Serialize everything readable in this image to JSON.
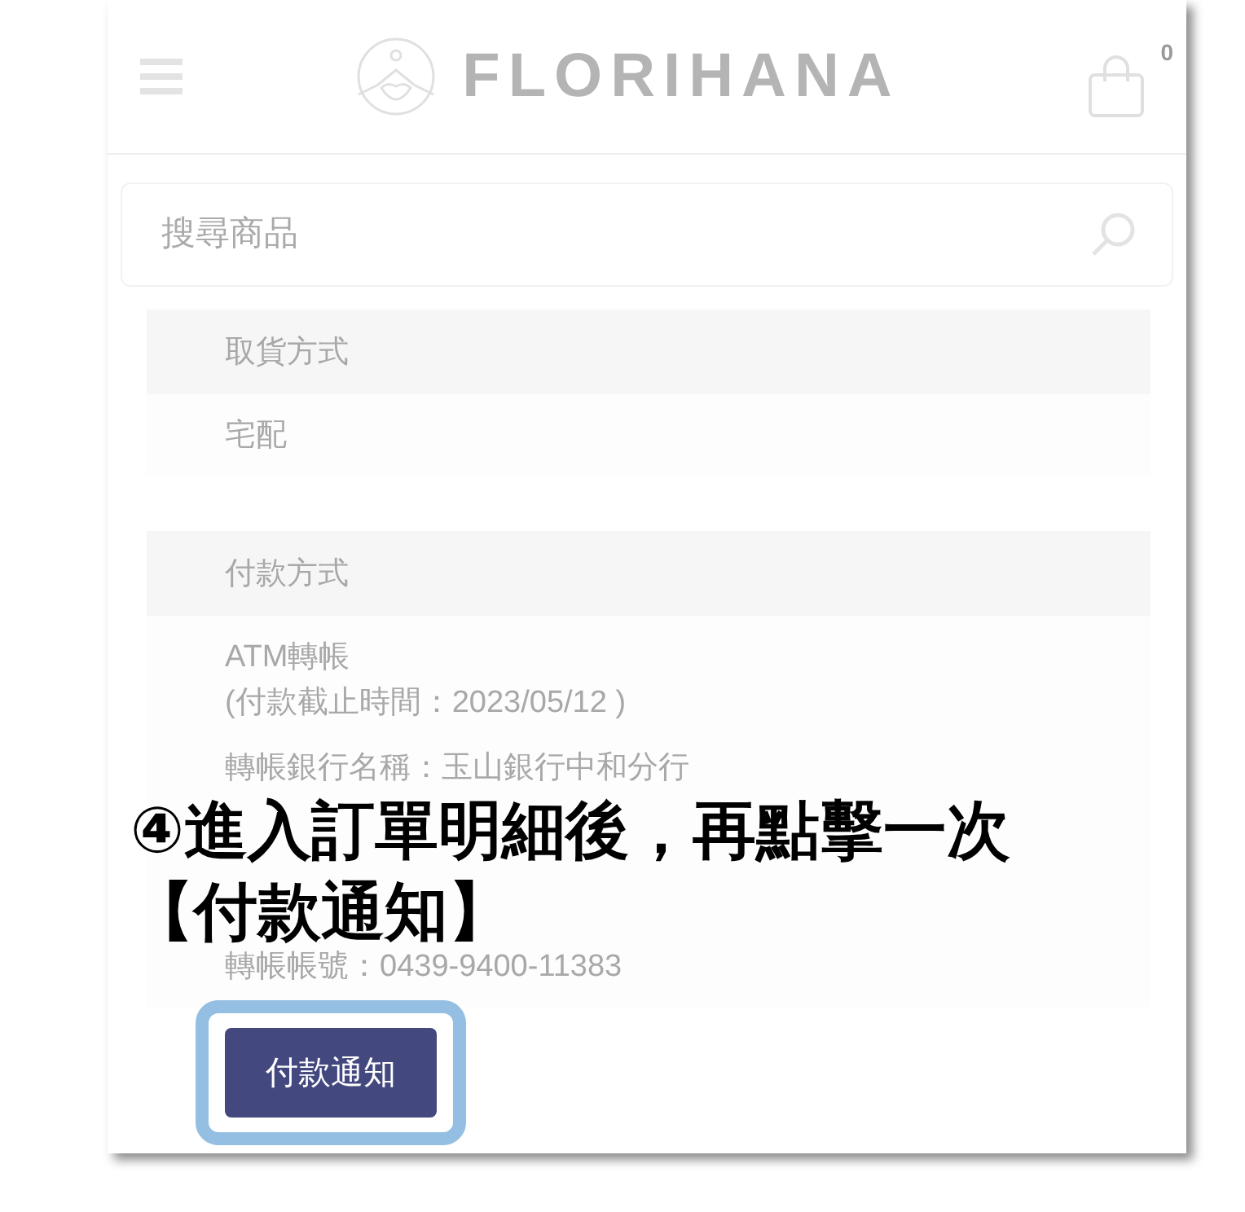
{
  "header": {
    "brand": "FLORIHANA",
    "cart_count": "0"
  },
  "search": {
    "placeholder": "搜尋商品"
  },
  "sections": [
    {
      "title": "取貨方式",
      "groups": [
        [
          "宅配"
        ]
      ]
    },
    {
      "title": "付款方式",
      "groups": [
        [
          "ATM轉帳",
          "(付款截止時間：2023/05/12 )"
        ],
        [
          "轉帳銀行名稱：玉山銀行中和分行"
        ],
        [
          "轉帳帳號：0439-9400-11383"
        ]
      ]
    }
  ],
  "button": {
    "label": "付款通知"
  },
  "annotation": {
    "lines": [
      "④進入訂單明細後，再點擊一次",
      "【付款通知】"
    ]
  }
}
